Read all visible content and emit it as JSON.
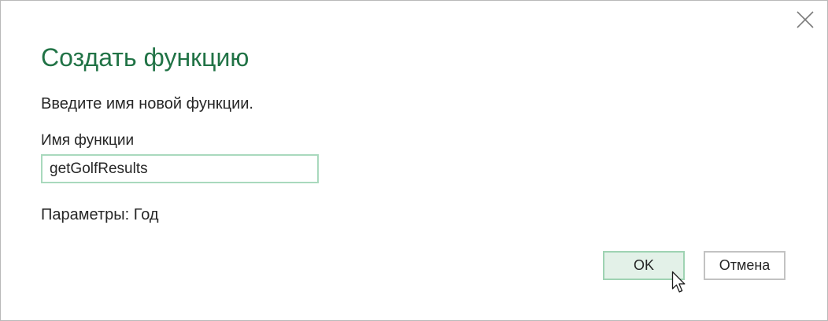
{
  "dialog": {
    "title": "Создать функцию",
    "prompt": "Введите имя новой функции.",
    "field_label": "Имя функции",
    "function_name_value": "getGolfResults",
    "parameters_text": "Параметры: Год",
    "ok_label": "OK",
    "cancel_label": "Отмена",
    "close_icon": "close-icon"
  },
  "colors": {
    "title": "#217346",
    "input_border": "#a9d9bd",
    "ok_background": "#e3f1e8",
    "ok_border": "#9fd3b3",
    "cancel_border": "#c2c2c2",
    "text": "#262626"
  },
  "cursor": {
    "icon": "mouse-pointer-icon"
  }
}
